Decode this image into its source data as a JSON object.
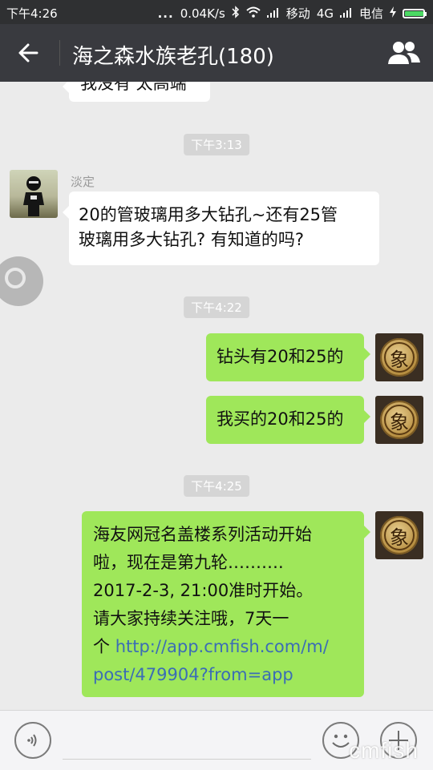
{
  "status": {
    "time": "下午4:26",
    "dots": "...",
    "speed": "0.04K/s",
    "carrier1": "移动",
    "net": "4G",
    "carrier2": "电信",
    "battery_level": 0.95,
    "battery_color": "#4cd964"
  },
  "header": {
    "title": "海之森水族老孔(180)",
    "back_icon": "arrow-left-icon",
    "members_icon": "group-icon"
  },
  "messages": {
    "partial": "我没有 太高端",
    "ts1": "下午3:13",
    "msg1_sender": "淡定",
    "msg1_line1": "20的管玻璃用多大钻孔~还有25管",
    "msg1_line2": "玻璃用多大钻孔? 有知道的吗?",
    "ts2": "下午4:22",
    "msg2": "钻头有20和25的",
    "msg3": "我买的20和25的",
    "ts3": "下午4:25",
    "msg4_line1": "海友网冠名盖楼系列活动开始",
    "msg4_line2": "啦，现在是第九轮……….",
    "msg4_line3": "2017-2-3, 21:00准时开始。",
    "msg4_line4": "请大家持续关注哦，7天一",
    "msg4_line5_prefix": "个 ",
    "msg4_line5_link": "http://app.cmfish.com/m/",
    "msg4_line6_link": "post/479904?from=app",
    "self_avatar_char": "象"
  },
  "bottom": {
    "voice_icon": "voice-icon",
    "emoji_icon": "emoji-icon",
    "plus_icon": "plus-icon",
    "watermark": "cmfish"
  },
  "colors": {
    "titlebar": "#393a3f",
    "chat_bg": "#ebebeb",
    "bubble_self": "#9fe75a",
    "link": "#3b6db5"
  }
}
